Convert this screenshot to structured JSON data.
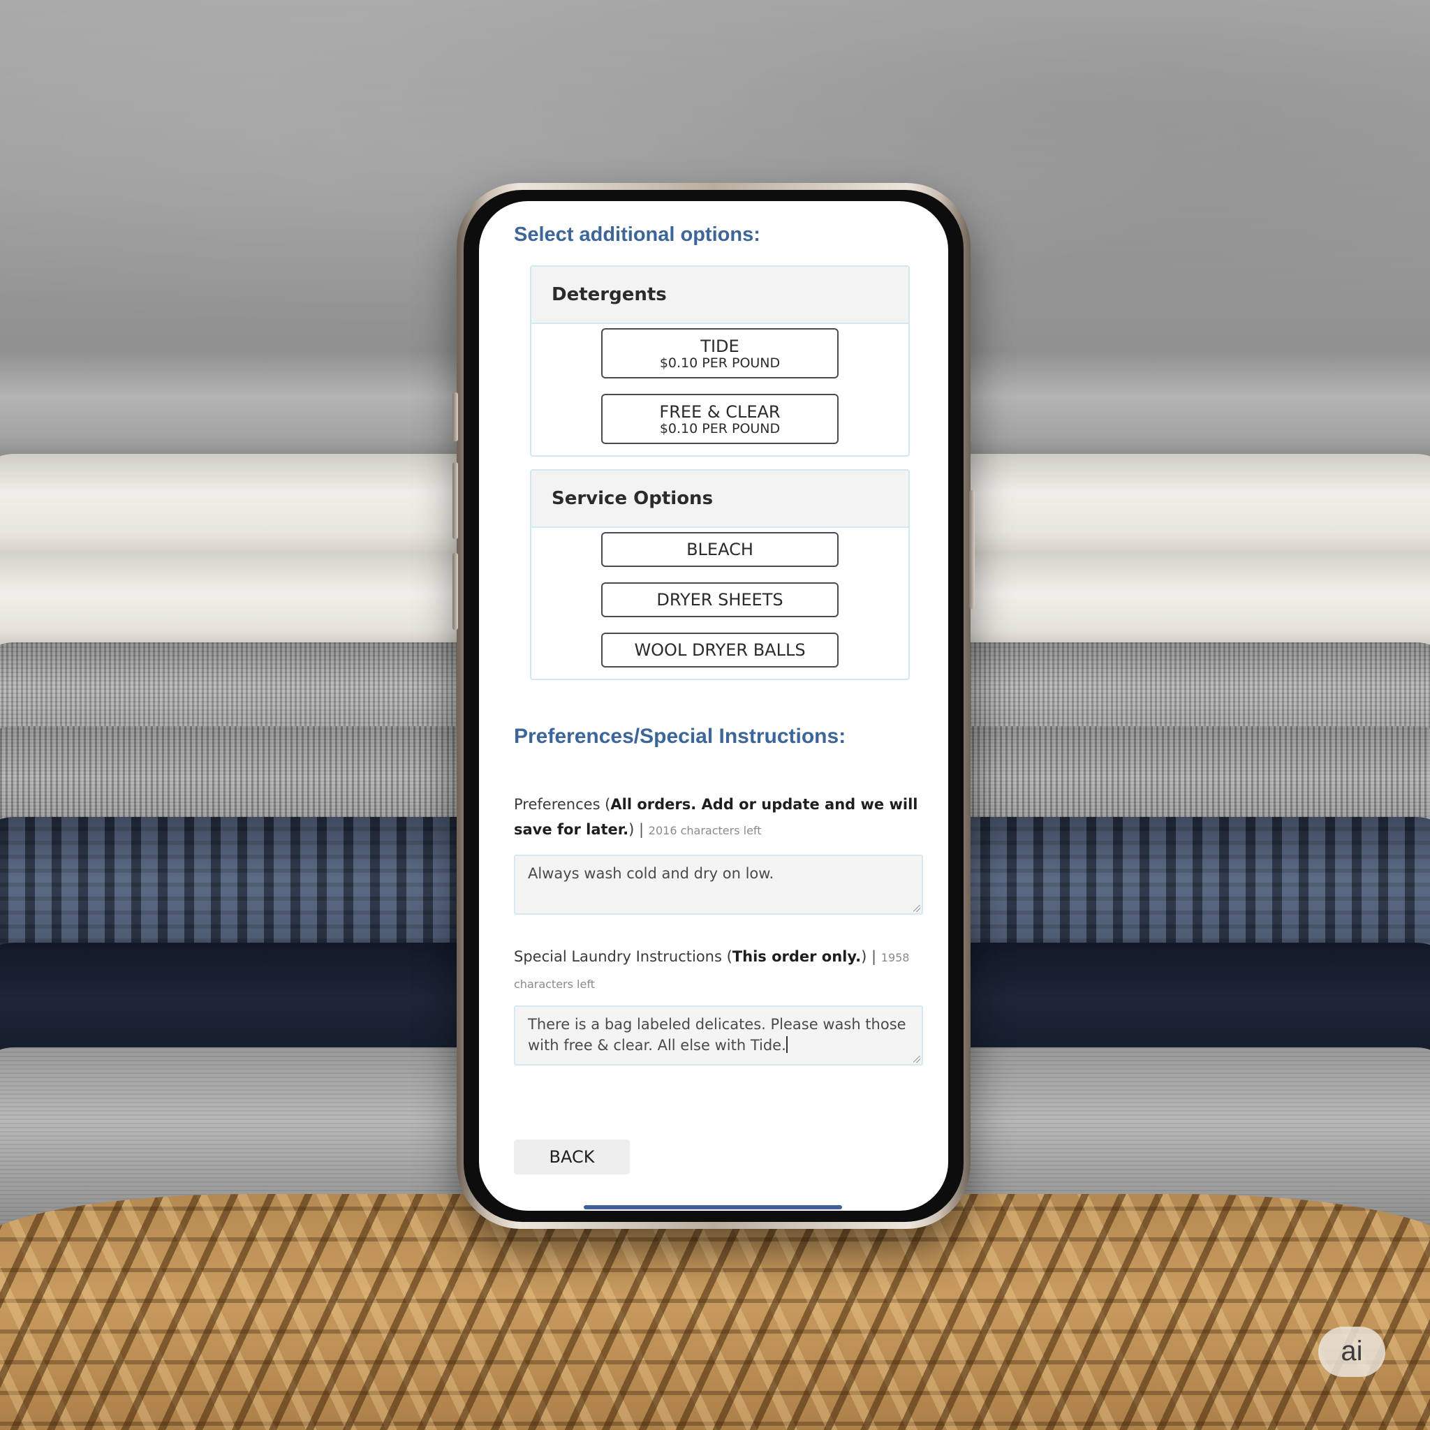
{
  "screen": {
    "options_heading": "Select additional options:",
    "detergents": {
      "title": "Detergents",
      "items": [
        {
          "name": "TIDE",
          "price": "$0.10 PER POUND"
        },
        {
          "name": "FREE & CLEAR",
          "price": "$0.10 PER POUND"
        }
      ]
    },
    "service_options": {
      "title": "Service Options",
      "items": [
        {
          "name": "BLEACH"
        },
        {
          "name": "DRYER SHEETS"
        },
        {
          "name": "WOOL DRYER BALLS"
        }
      ]
    },
    "prefs_heading": "Preferences/Special Instructions:",
    "preferences": {
      "label_prefix": "Preferences (",
      "label_bold": "All orders. Add or update and we will save for later.",
      "label_suffix": ")",
      "separator": " | ",
      "chars_left": "2016 characters left",
      "value": "Always wash cold and dry on low."
    },
    "special": {
      "label_prefix": "Special Laundry Instructions (",
      "label_bold": "This order only.",
      "label_suffix": ")",
      "separator": " | ",
      "chars_left": "1958 characters left",
      "value": "There is a bag labeled delicates. Please wash those with free & clear. All else with Tide."
    },
    "back_label": "BACK"
  },
  "badge": {
    "label": "ai"
  },
  "colors": {
    "heading_blue": "#3c6699",
    "panel_border": "#cfe9ef",
    "button_border": "#4b4b55"
  },
  "icons": [
    "resize-handle-icon"
  ]
}
